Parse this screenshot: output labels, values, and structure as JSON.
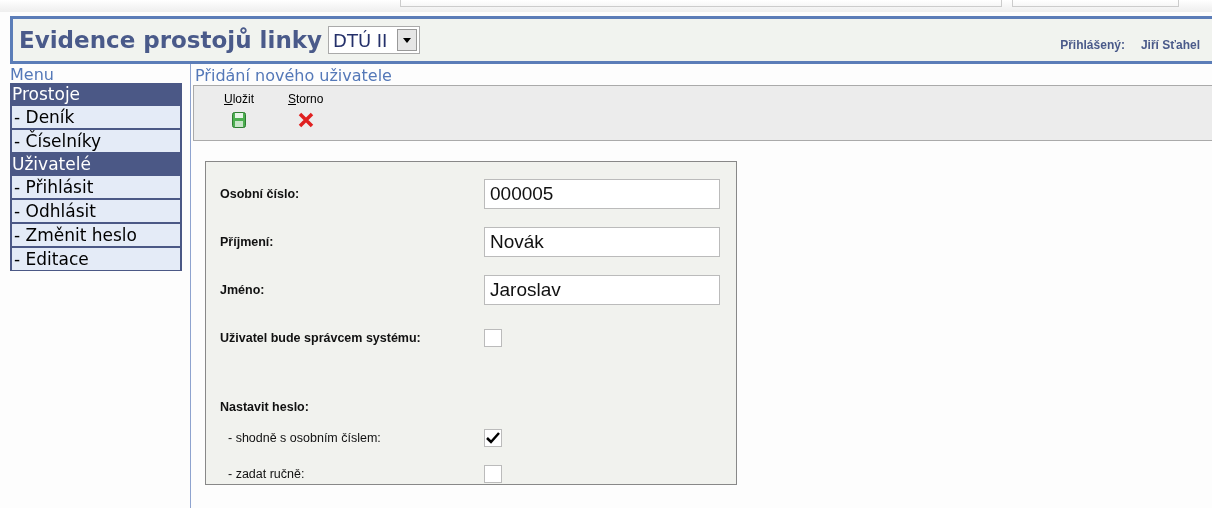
{
  "header": {
    "title": "Evidence prostojů linky",
    "line_select": {
      "value": "DTÚ II"
    },
    "login_label": "Přihlášený:",
    "user_name": "Jiří Sťahel"
  },
  "menu": {
    "title": "Menu",
    "items": [
      {
        "label": "Prostoje",
        "kind": "section",
        "selected": false
      },
      {
        "label": "- Deník",
        "kind": "link",
        "selected": false
      },
      {
        "label": "- Číselníky",
        "kind": "link",
        "selected": false
      },
      {
        "label": "Uživatelé",
        "kind": "section",
        "selected": false
      },
      {
        "label": "- Přihlásit",
        "kind": "link",
        "selected": false
      },
      {
        "label": "- Odhlásit",
        "kind": "link",
        "selected": false
      },
      {
        "label": "- Změnit heslo",
        "kind": "link",
        "selected": false
      },
      {
        "label": "- Editace",
        "kind": "link",
        "selected": false
      }
    ]
  },
  "page_title": "Přidání nového uživatele",
  "toolbar": [
    {
      "label": "Uložit",
      "kind": "save"
    },
    {
      "label": "Storno",
      "kind": "cancel"
    }
  ],
  "form": [
    {
      "kind": "text",
      "label": "Osobní číslo:",
      "value": "000005"
    },
    {
      "kind": "text",
      "label": "Příjmení:",
      "value": "Novák"
    },
    {
      "kind": "text",
      "label": "Jméno:",
      "value": "Jaroslav"
    },
    {
      "kind": "checkbox",
      "label": "Uživatel bude správcem systému:",
      "checked": false
    },
    {
      "kind": "heading",
      "label": "Nastavit heslo:"
    },
    {
      "kind": "option",
      "label": "- shodně s osobním číslem:",
      "checked": true
    },
    {
      "kind": "option",
      "label": "- zadat ručně:",
      "checked": false
    }
  ]
}
